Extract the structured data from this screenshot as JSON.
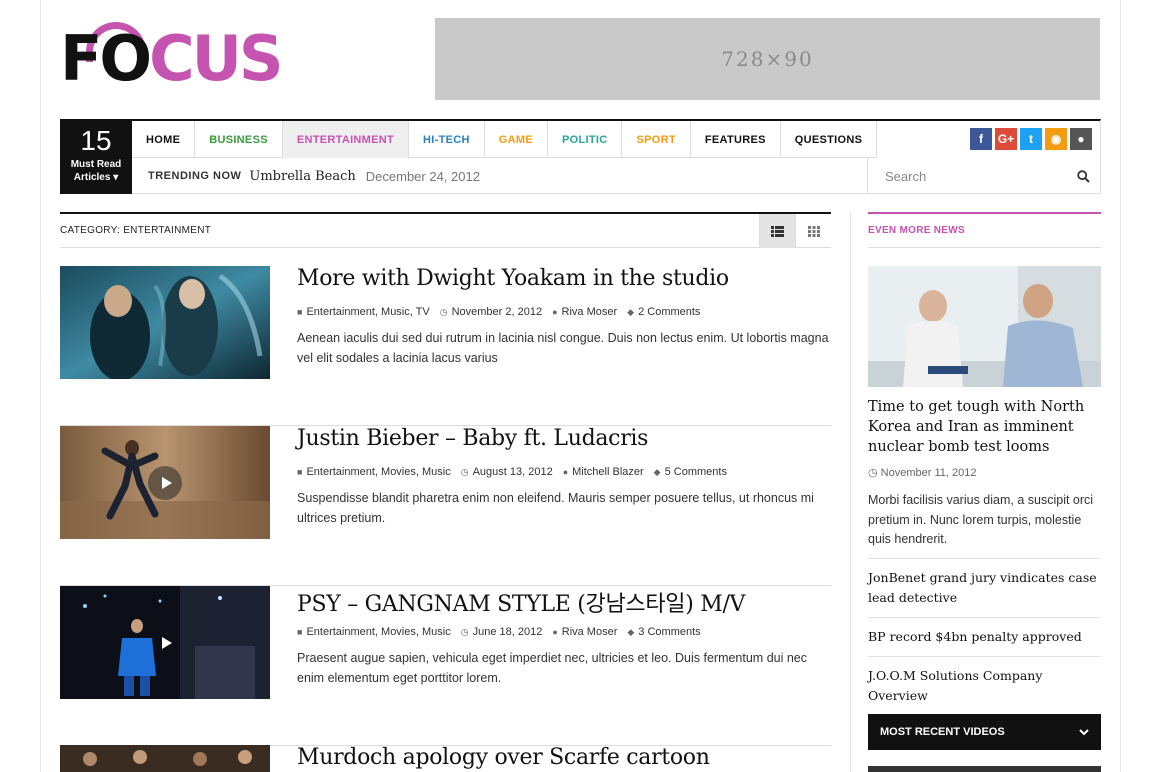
{
  "header": {
    "logo_text_dark": "FO",
    "logo_text_color": "CUS",
    "ad_label": "728×90"
  },
  "nav": {
    "must_read": {
      "count": "15",
      "label_line1": "Must Read",
      "label_line2": "Articles ▾"
    },
    "menu": [
      {
        "label": "HOME",
        "color": "#111111"
      },
      {
        "label": "BUSINESS",
        "color": "#3c9a3c"
      },
      {
        "label": "ENTERTAINMENT",
        "color": "#c553b0"
      },
      {
        "label": "HI-TECH",
        "color": "#2a7fc1"
      },
      {
        "label": "GAME",
        "color": "#f39c12"
      },
      {
        "label": "POLITIC",
        "color": "#26a69a"
      },
      {
        "label": "SPORT",
        "color": "#f39c12"
      },
      {
        "label": "FEATURES",
        "color": "#111111"
      },
      {
        "label": "QUESTIONS",
        "color": "#111111"
      }
    ],
    "social": [
      {
        "icon": "facebook-icon",
        "glyph": "f",
        "color": "#3b5998"
      },
      {
        "icon": "google-plus-icon",
        "glyph": "G+",
        "color": "#dd4b39"
      },
      {
        "icon": "twitter-icon",
        "glyph": "t",
        "color": "#1da1f2"
      },
      {
        "icon": "rss-icon",
        "glyph": "◉",
        "color": "#f39c12"
      },
      {
        "icon": "user-icon",
        "glyph": "●",
        "color": "#555555"
      }
    ],
    "trending": {
      "label": "TRENDING NOW",
      "title": "Umbrella Beach",
      "date": "December 24, 2012"
    },
    "search_placeholder": "Search"
  },
  "category": {
    "title": "CATEGORY: ENTERTAINMENT"
  },
  "posts": [
    {
      "title": "More with Dwight Yoakam in the studio",
      "categories": "Entertainment, Music, TV",
      "date": "November 2, 2012",
      "author": "Riva Moser",
      "comments": "2 Comments",
      "excerpt": "Aenean iaculis dui sed dui rutrum in lacinia nisl congue. Duis non lectus enim. Ut lobortis magna vel elit sodales a lacinia lacus varius"
    },
    {
      "title": "Justin Bieber – Baby ft. Ludacris",
      "categories": "Entertainment, Movies, Music",
      "date": "August 13, 2012",
      "author": "Mitchell Blazer",
      "comments": "5 Comments",
      "excerpt": "Suspendisse blandit pharetra enim non eleifend. Mauris semper posuere tellus, ut rhoncus mi ultrices pretium."
    },
    {
      "title": "PSY – GANGNAM STYLE (강남스타일) M/V",
      "categories": "Entertainment, Movies, Music",
      "date": "June 18, 2012",
      "author": "Riva Moser",
      "comments": "3 Comments",
      "excerpt": "Praesent augue sapien, vehicula eget imperdiet nec, ultricies et leo. Duis fermentum dui nec enim elementum eget porttitor lorem."
    },
    {
      "title": "Murdoch apology over Scarfe cartoon"
    }
  ],
  "sidebar": {
    "heading": "EVEN MORE NEWS",
    "featured": {
      "title": "Time to get tough with North Korea and Iran as imminent nuclear bomb test looms",
      "date": "November 11, 2012",
      "excerpt": "Morbi facilisis varius diam, a suscipit orci pretium in. Nunc lorem turpis, molestie quis hendrerit."
    },
    "links": [
      "JonBenet grand jury vindicates case lead detective",
      "BP record $4bn penalty approved",
      "J.O.O.M Solutions Company Overview"
    ],
    "videos_heading": "MOST RECENT VIDEOS"
  }
}
